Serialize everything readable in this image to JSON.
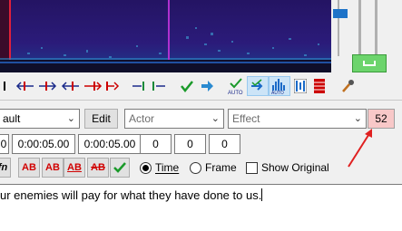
{
  "editor": {
    "style_value": "ault",
    "edit_label": "Edit",
    "actor_placeholder": "Actor",
    "effect_placeholder": "Effect",
    "char_count": "52",
    "times": [
      "0",
      "0:00:05.00",
      "0:00:05.00"
    ],
    "margins": [
      "0",
      "0",
      "0"
    ],
    "format_buttons": [
      "fn",
      "AB",
      "AB",
      "AB",
      "AB"
    ],
    "time_label": "Time",
    "frame_label": "Frame",
    "show_original_label": "Show Original",
    "subtitle_text": "ur enemies will pay for what they have done to us."
  },
  "colors": {
    "count_bg": "#f8c8c8",
    "arrow": "#e02020",
    "spectro_bg": "#2b1b78",
    "accent_green": "#4caf50"
  }
}
